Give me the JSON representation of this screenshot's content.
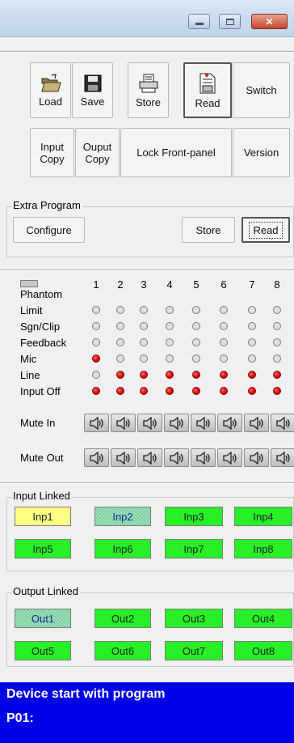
{
  "toolbar": {
    "row1": [
      {
        "label": "Load",
        "icon": "folder-open-icon"
      },
      {
        "label": "Save",
        "icon": "floppy-disk-icon"
      },
      {
        "label": "Store",
        "icon": "printer-icon"
      },
      {
        "label": "Read",
        "icon": "document-read-icon"
      },
      {
        "label": "Switch"
      }
    ],
    "row2": [
      {
        "label": "Input\nCopy"
      },
      {
        "label": "Ouput\nCopy"
      },
      {
        "label": "Lock Front-panel"
      },
      {
        "label": "Version"
      }
    ]
  },
  "extra_program": {
    "title": "Extra Program",
    "configure": "Configure",
    "store": "Store",
    "read": "Read"
  },
  "grid": {
    "columns": [
      "1",
      "2",
      "3",
      "4",
      "5",
      "6",
      "7",
      "8"
    ],
    "rows": [
      {
        "label": "Phantom",
        "states": [
          "phantom",
          "",
          "",
          "",
          "",
          "",
          "",
          ""
        ]
      },
      {
        "label": "Limit",
        "states": [
          "gray",
          "gray",
          "gray",
          "gray",
          "gray",
          "gray",
          "gray",
          "gray"
        ]
      },
      {
        "label": "Sgn/Clip",
        "states": [
          "gray",
          "gray",
          "gray",
          "gray",
          "gray",
          "gray",
          "gray",
          "gray"
        ]
      },
      {
        "label": "Feedback",
        "states": [
          "gray",
          "gray",
          "gray",
          "gray",
          "gray",
          "gray",
          "gray",
          "gray"
        ]
      },
      {
        "label": "Mic",
        "states": [
          "red",
          "gray",
          "gray",
          "gray",
          "gray",
          "gray",
          "gray",
          "gray"
        ]
      },
      {
        "label": "Line",
        "states": [
          "gray",
          "red",
          "red",
          "red",
          "red",
          "red",
          "red",
          "red"
        ]
      },
      {
        "label": "Input Off",
        "states": [
          "red",
          "red",
          "red",
          "red",
          "red",
          "red",
          "red",
          "red"
        ]
      }
    ],
    "mute_in": "Mute In",
    "mute_out": "Mute Out"
  },
  "input_linked": {
    "title": "Input Linked",
    "items": [
      "Inp1",
      "Inp2",
      "Inp3",
      "Inp4",
      "Inp5",
      "Inp6",
      "Inp7",
      "Inp8"
    ],
    "styles": [
      "yellow",
      "hatch",
      "green",
      "green",
      "green",
      "green",
      "green",
      "green"
    ]
  },
  "output_linked": {
    "title": "Output Linked",
    "items": [
      "Out1",
      "Out2",
      "Out3",
      "Out4",
      "Out5",
      "Out6",
      "Out7",
      "Out8"
    ],
    "styles": [
      "hatch",
      "green",
      "green",
      "green",
      "green",
      "green",
      "green",
      "green"
    ]
  },
  "status": {
    "line1": "Device start with program",
    "line2": "P01:"
  },
  "colors": {
    "status_bg": "#0000e6",
    "led_red": "#d10000",
    "link_green": "#27f027",
    "link_yellow": "#ffff85"
  }
}
